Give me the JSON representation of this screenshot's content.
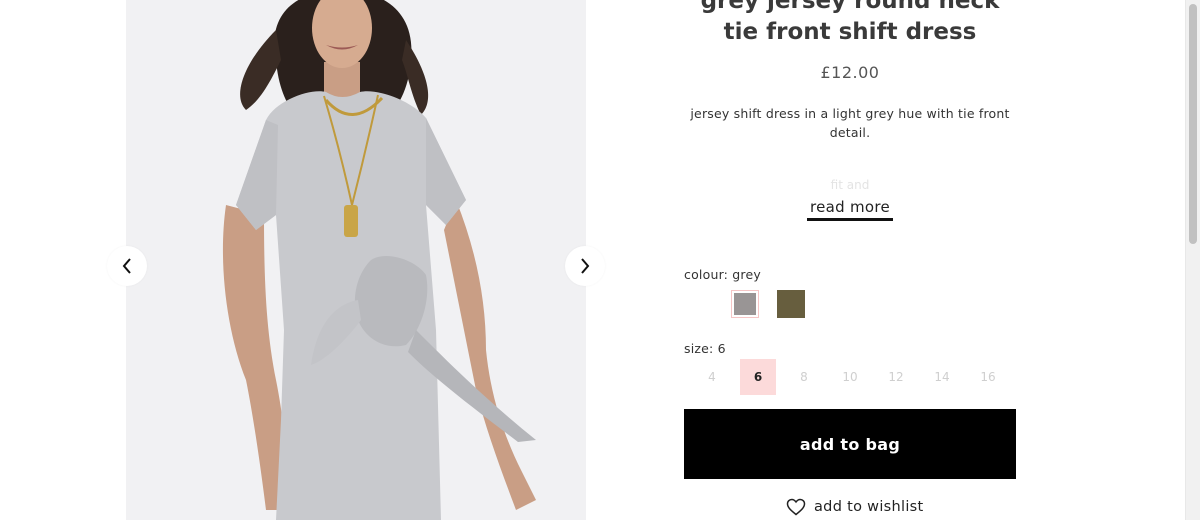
{
  "product": {
    "title": "grey jersey round neck tie front shift dress",
    "price": "£12.00",
    "description": "jersey shift dress in a light grey hue with tie front detail.",
    "faded_text": "fit and",
    "read_more_label": "read more"
  },
  "colour": {
    "label": "colour: grey",
    "swatches": [
      {
        "name": "grey",
        "hex": "#999595",
        "selected": true
      },
      {
        "name": "khaki",
        "hex": "#675e3e",
        "selected": false
      }
    ]
  },
  "size": {
    "label": "size: 6",
    "options": [
      "4",
      "6",
      "8",
      "10",
      "12",
      "14",
      "16"
    ],
    "selected": "6"
  },
  "actions": {
    "add_to_bag": "add to bag",
    "add_to_wishlist": "add to wishlist"
  },
  "icons": {
    "prev": "chevron-left-icon",
    "next": "chevron-right-icon",
    "wishlist": "heart-icon"
  },
  "colors": {
    "selected_size_bg": "#fcdada",
    "button_bg": "#000000",
    "image_bg": "#f1f1f3"
  }
}
